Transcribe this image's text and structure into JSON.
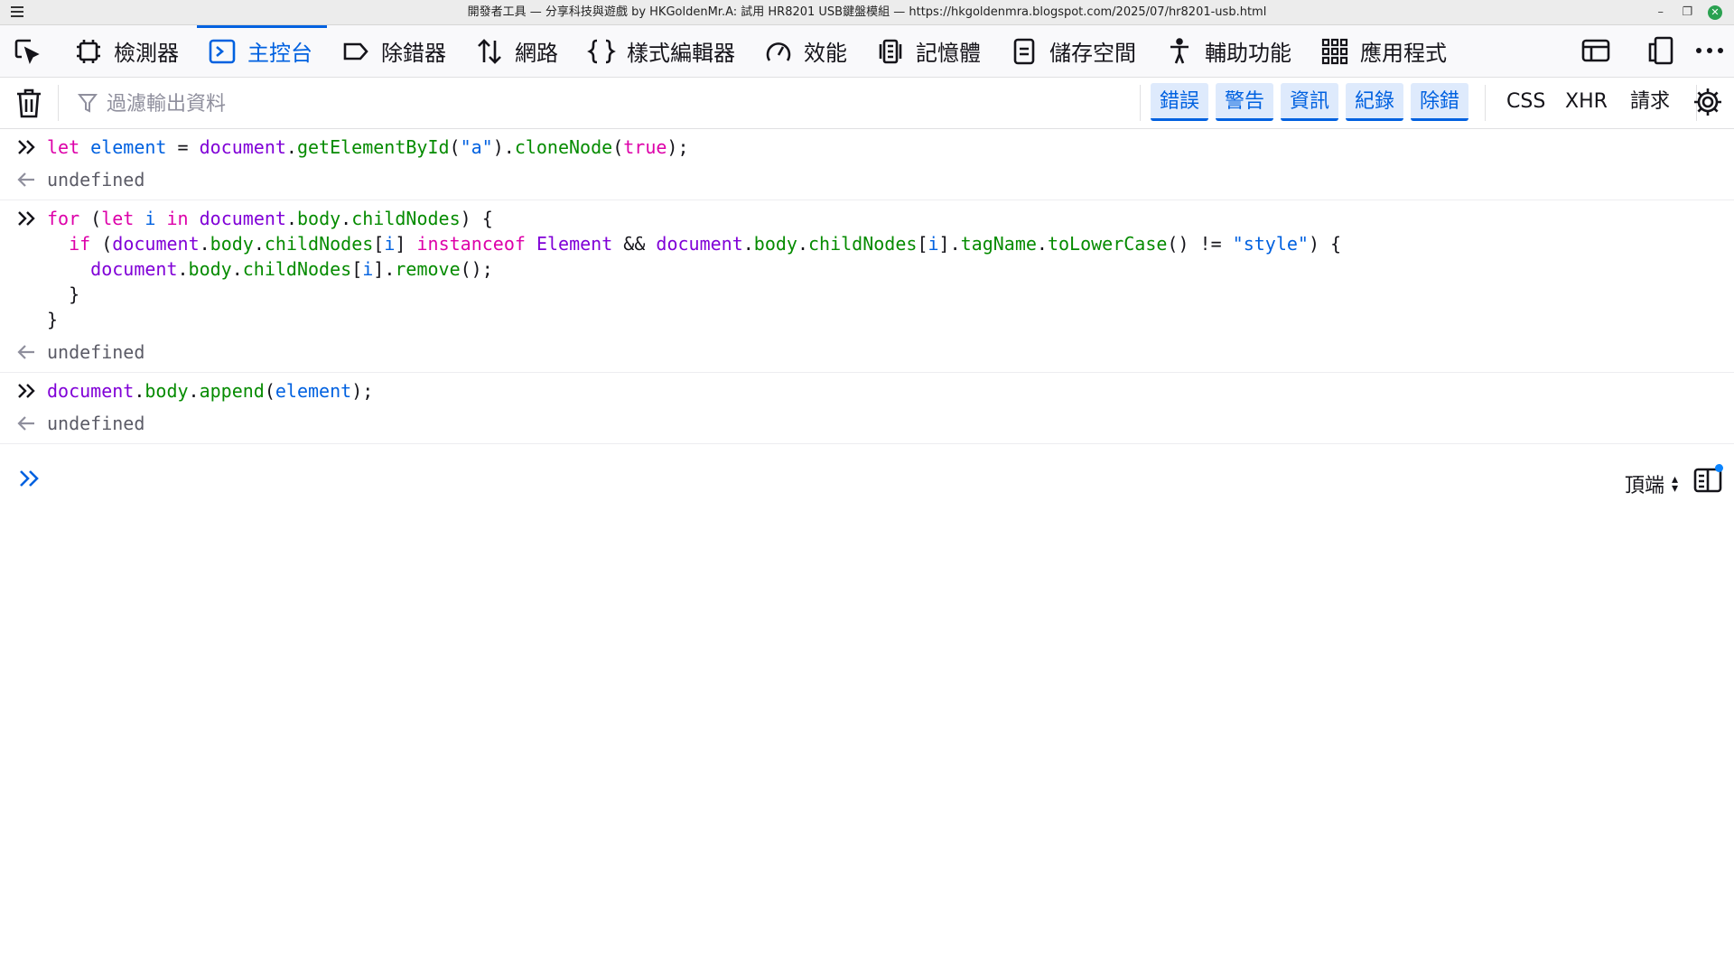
{
  "window": {
    "title": "開發者工具 — 分享科技與遊戲 by HKGoldenMr.A: 試用 HR8201 USB鍵盤模組 — https://hkgoldenmra.blogspot.com/2025/07/hr8201-usb.html",
    "minimize": "–",
    "restore": "❐",
    "close": "✕"
  },
  "tools": [
    {
      "label": "",
      "icon": "element-picker-icon"
    },
    {
      "label": "檢測器",
      "icon": "inspector-icon"
    },
    {
      "label": "主控台",
      "icon": "console-icon",
      "active": true
    },
    {
      "label": "除錯器",
      "icon": "debugger-icon"
    },
    {
      "label": "網路",
      "icon": "network-icon"
    },
    {
      "label": "樣式編輯器",
      "icon": "style-editor-icon"
    },
    {
      "label": "效能",
      "icon": "performance-icon"
    },
    {
      "label": "記憶體",
      "icon": "memory-icon"
    },
    {
      "label": "儲存空間",
      "icon": "storage-icon"
    },
    {
      "label": "輔助功能",
      "icon": "accessibility-icon"
    },
    {
      "label": "應用程式",
      "icon": "application-icon"
    }
  ],
  "filter": {
    "placeholder": "過濾輸出資料",
    "levels": [
      "錯誤",
      "警告",
      "資訊",
      "紀錄",
      "除錯"
    ],
    "extra": [
      "CSS",
      "XHR",
      "請求"
    ]
  },
  "console": {
    "entries": [
      {
        "command": "let element = document.getElementById(\"a\").cloneNode(true);",
        "result": "undefined"
      },
      {
        "command": "for (let i in document.body.childNodes) {\n  if (document.body.childNodes[i] instanceof Element && document.body.childNodes[i].tagName.toLowerCase() != \"style\") {\n    document.body.childNodes[i].remove();\n  }\n}",
        "result": "undefined"
      },
      {
        "command": "document.body.append(element);",
        "result": "undefined"
      }
    ],
    "context_selector": "頂端"
  }
}
